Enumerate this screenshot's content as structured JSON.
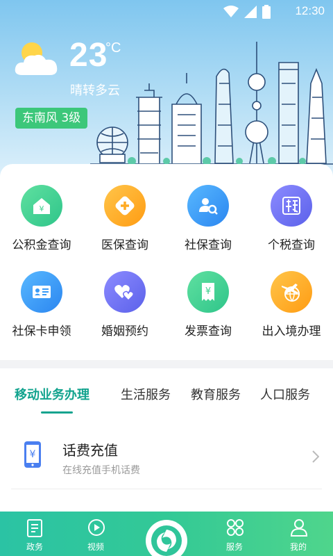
{
  "status_bar": {
    "time": "12:30",
    "icons": [
      "wifi-icon",
      "signal-icon",
      "battery-icon"
    ]
  },
  "weather": {
    "temperature": "23",
    "unit": "°C",
    "description": "晴转多云",
    "wind": "东南风  3级"
  },
  "services": [
    {
      "label": "公积金查询",
      "icon": "housing-fund-icon",
      "color": "#3fd08f"
    },
    {
      "label": "医保查询",
      "icon": "medical-insurance-icon",
      "color": "#ffab24"
    },
    {
      "label": "社保查询",
      "icon": "social-security-search-icon",
      "color": "#3a9bf7"
    },
    {
      "label": "个税查询",
      "icon": "tax-icon",
      "color": "#6f6ff4"
    },
    {
      "label": "社保卡申领",
      "icon": "id-card-icon",
      "color": "#3a9bf7"
    },
    {
      "label": "婚姻预约",
      "icon": "hearts-icon",
      "color": "#6f6ff4"
    },
    {
      "label": "发票查询",
      "icon": "invoice-icon",
      "color": "#3fd08f"
    },
    {
      "label": "出入境办理",
      "icon": "plane-globe-icon",
      "color": "#ffab24"
    }
  ],
  "tabs": [
    {
      "label": "移动业务办理",
      "active": true
    },
    {
      "label": "生活服务",
      "active": false
    },
    {
      "label": "教育服务",
      "active": false
    },
    {
      "label": "人口服务",
      "active": false
    }
  ],
  "list": [
    {
      "title": "话费充值",
      "subtitle": "在线充值手机话费",
      "icon": "phone-yuan-icon"
    }
  ],
  "bottom_nav": [
    {
      "label": "政务",
      "icon": "document-icon"
    },
    {
      "label": "视频",
      "icon": "play-icon"
    },
    {
      "label": "",
      "icon": "home-logo-icon"
    },
    {
      "label": "服务",
      "icon": "grid-service-icon"
    },
    {
      "label": "我的",
      "icon": "user-icon"
    }
  ],
  "colors": {
    "accent": "#12a38e",
    "nav_gradient_start": "#2bc3a4",
    "nav_gradient_end": "#4fd58c"
  }
}
